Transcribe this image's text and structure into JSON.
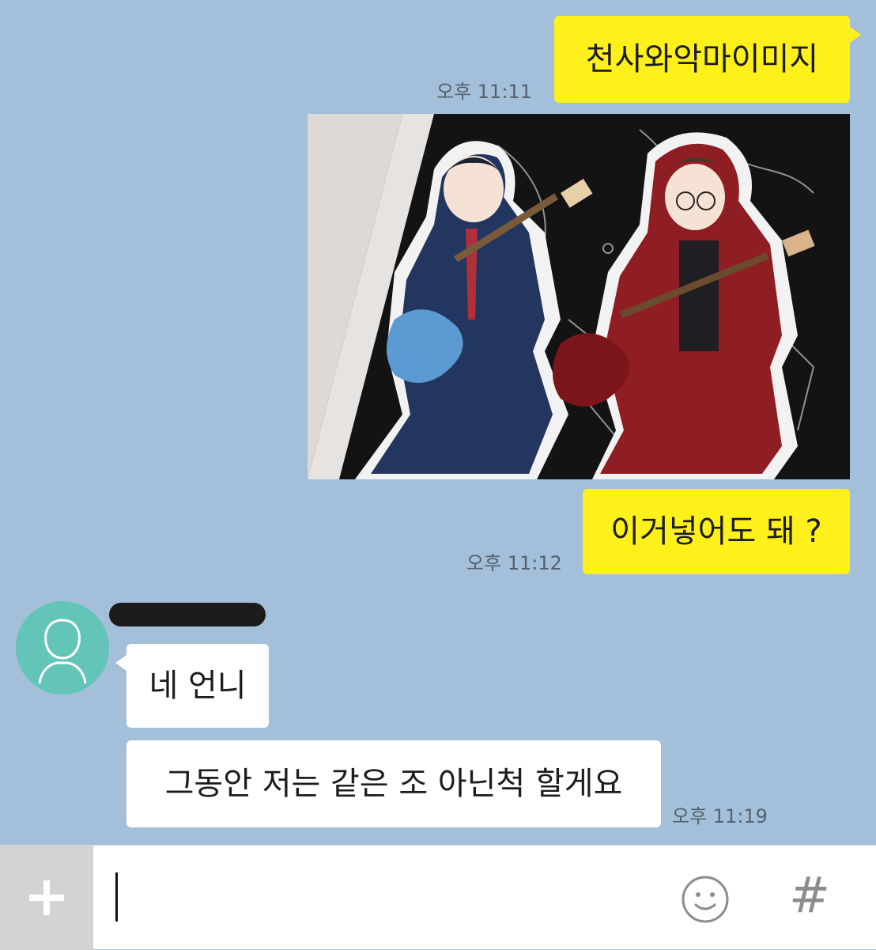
{
  "messages": {
    "m1": {
      "text": "천사와악마이미지",
      "time": "오후 11:11"
    },
    "m3": {
      "text": "이거넣어도 돼 ?",
      "time": "오후 11:12"
    },
    "m4": {
      "text": "네 언니"
    },
    "m5": {
      "text": "그동안 저는 같은 조 아닌척 할게요",
      "time": "오후 11:19"
    }
  },
  "input": {
    "plus_icon": "plus-icon",
    "emoji_icon": "emoji-icon",
    "hash_icon": "hash-icon",
    "hash_label": "#"
  },
  "colors": {
    "chat_bg": "#a3bfd9",
    "my_bubble": "#fef01b",
    "their_bubble": "#ffffff",
    "avatar": "#62c5b8"
  }
}
